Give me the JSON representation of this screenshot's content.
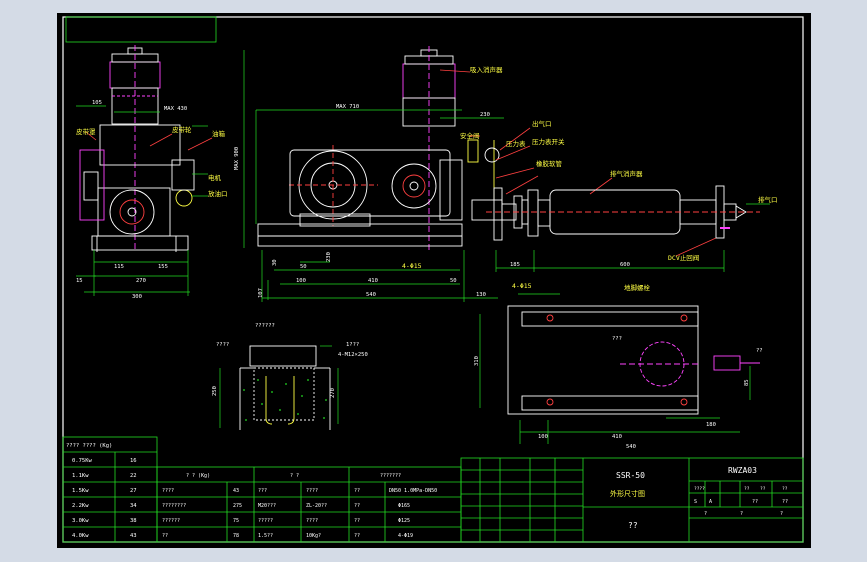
{
  "colors": {
    "paper": "#000000",
    "frame": "#ffffff",
    "dim": "#22dd22",
    "part": "#ffffff",
    "accent": "#ff44ff",
    "label": "#ffff44",
    "red": "#ff3030",
    "hatch": "#44ccff"
  },
  "title_block": {
    "model": "SSR-50",
    "subtitle": "外形尺寸图",
    "drawing_no": "RWZA03",
    "name_placeholder": "??",
    "cells": [
      "????",
      "??",
      "??",
      "??",
      "S",
      "A",
      "??",
      "??",
      "?",
      "?",
      "?"
    ]
  },
  "callouts": {
    "inlet_silencer": "吸入消声器",
    "outlet": "出气口",
    "safety_valve": "安全阀",
    "pressure_gauge": "压力表",
    "gauge_valve": "压力表开关",
    "flex_joint": "橡胶软管",
    "outlet_silencer": "排气消声器",
    "check_valve": "DCV止回阀",
    "exhaust_port": "排气口",
    "belt_guard": "皮带罩",
    "motor": "电机",
    "pulley": "皮带轮",
    "oil_tank": "油箱",
    "oil_drain": "放油口",
    "oil_level": "油位",
    "hole_label": "4-Φ15",
    "hole_label_2": "4-Φ15",
    "anchor": "地脚螺栓",
    "base_note": "??????",
    "base_label": "1???",
    "anchor_spec": "4-M12×250",
    "foundation_label": "????",
    "plan_label": "???",
    "plan_out": "??"
  },
  "dimensions": {
    "front_width_top": "105",
    "front_height_label": "MAX 430",
    "front_bottom_a": "115",
    "front_bottom_b": "155",
    "front_bottom_total": "270",
    "front_overall": "300",
    "front_side": "15",
    "side_max": "MAX 710",
    "side_top_right": "230",
    "side_height": "MAX 900",
    "side_a": "50",
    "side_b": "230",
    "side_c": "100",
    "side_d": "410",
    "side_e": "540",
    "side_f": "50",
    "side_g": "130",
    "side_h": "107",
    "side_i": "30",
    "pipe_a": "185",
    "pipe_b": "600",
    "found_h": "250",
    "found_h2": "270",
    "plan_h": "310",
    "plan_a": "100",
    "plan_b": "410",
    "plan_c": "180",
    "plan_total": "540",
    "plan_side": "85"
  },
  "spec_table": {
    "header": "???? ???? (Kg)",
    "rows": [
      {
        "power": "0.75Kw",
        "weight": "16"
      },
      {
        "power": "1.1Kw",
        "weight": "22"
      },
      {
        "power": "1.5Kw",
        "weight": "27"
      },
      {
        "power": "2.2Kw",
        "weight": "34"
      },
      {
        "power": "3.0Kw",
        "weight": "38"
      },
      {
        "power": "4.0Kw",
        "weight": "43"
      }
    ]
  },
  "param_table": {
    "headers": [
      "? ?   (Kg)",
      "? ?",
      "???????"
    ],
    "rows": [
      [
        "????",
        "43",
        "???",
        "????",
        "??",
        "DN50 1.0MPa-DN50"
      ],
      [
        "????????",
        "275",
        "M20???",
        "ZL-20??",
        "??",
        "Φ165"
      ],
      [
        "??????",
        "75",
        "?????",
        "????",
        "??",
        "Φ125"
      ],
      [
        "??",
        "78",
        "1.5??",
        "10Kg?",
        "??",
        "4-Φ19"
      ]
    ]
  }
}
